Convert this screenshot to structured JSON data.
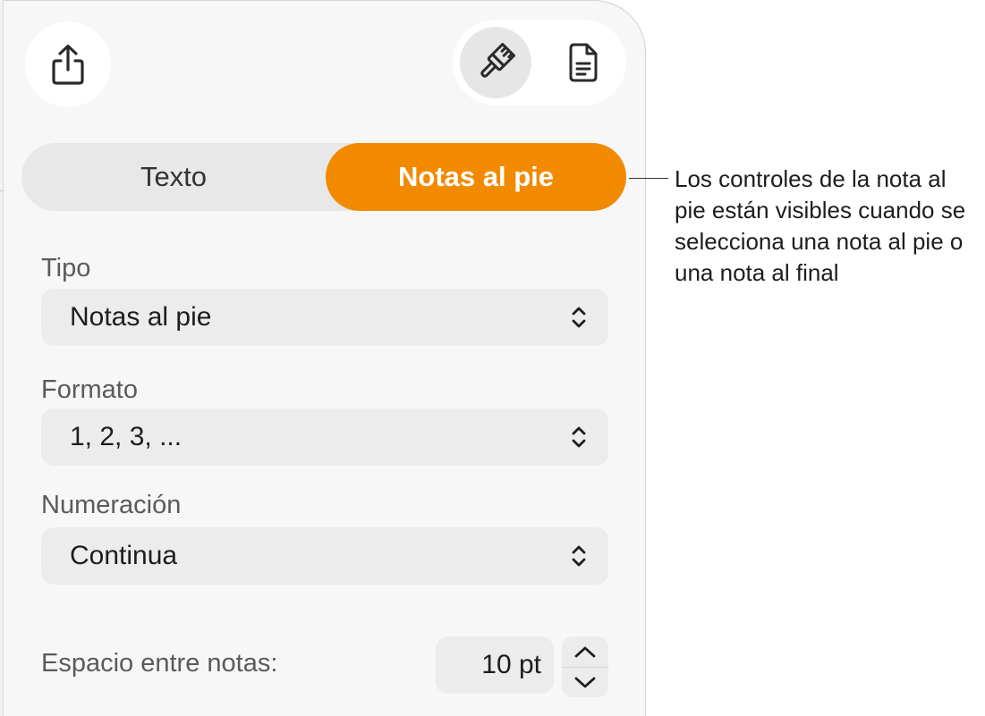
{
  "toolbar": {
    "share_icon": "share-icon",
    "format_icon": "paintbrush-icon",
    "document_icon": "document-icon"
  },
  "segmented": {
    "text_label": "Texto",
    "footnotes_label": "Notas al pie",
    "selected": "Notas al pie",
    "accent_color": "#f28a00"
  },
  "type": {
    "label": "Tipo",
    "value": "Notas al pie"
  },
  "format": {
    "label": "Formato",
    "value": "1, 2, 3, ..."
  },
  "numbering": {
    "label": "Numeración",
    "value": "Continua"
  },
  "spacing": {
    "label": "Espacio entre notas:",
    "value": "10 pt"
  },
  "callout": {
    "text": "Los controles de la nota al pie están visibles cuando se selecciona una nota al pie o una nota al final"
  }
}
